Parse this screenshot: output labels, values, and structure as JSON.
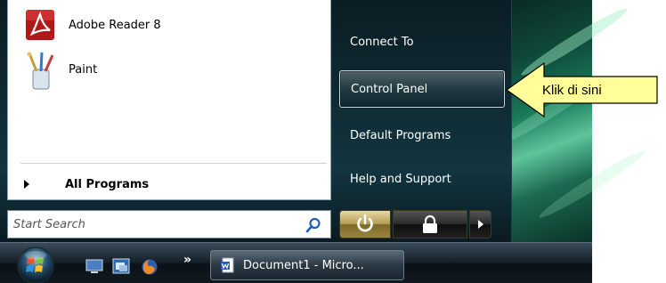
{
  "start_menu": {
    "programs": [
      {
        "label": "Adobe Reader 8",
        "icon": "adobe-reader-icon"
      },
      {
        "label": "Paint",
        "icon": "paint-icon"
      }
    ],
    "all_programs_label": "All Programs",
    "search": {
      "placeholder": "Start Search",
      "icon": "search-icon"
    },
    "right_items": [
      {
        "label": "Connect To"
      },
      {
        "label": "Control Panel",
        "highlighted": true
      },
      {
        "label": "Default Programs"
      },
      {
        "label": "Help and Support"
      }
    ],
    "power_buttons": {
      "power_icon": "power-icon",
      "lock_icon": "lock-icon",
      "arrow_icon": "arrow-right-icon"
    }
  },
  "taskbar": {
    "start_orb_icon": "windows-orb-icon",
    "quick_launch": [
      "show-desktop-icon",
      "switch-windows-icon",
      "firefox-icon"
    ],
    "overflow_label": "»",
    "tasks": [
      {
        "label": "Document1 - Micro...",
        "icon": "word-document-icon"
      }
    ]
  },
  "callout": {
    "text": "Klik di sini"
  },
  "colors": {
    "callout_fill": "#ffff99",
    "power_button": "#b59d54",
    "menu_bg": "#0f2a32"
  }
}
